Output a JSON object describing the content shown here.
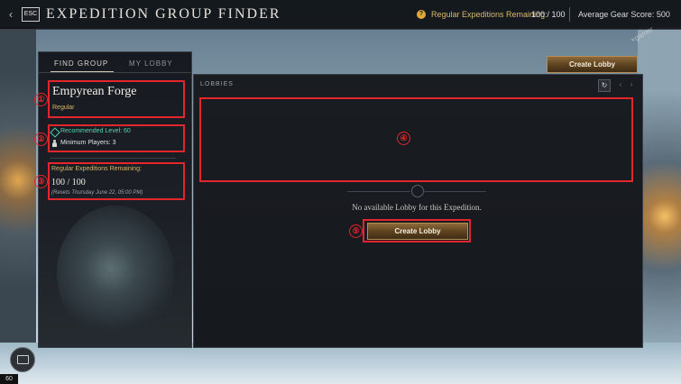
{
  "topbar": {
    "esc_label": "ESC",
    "back_icon": "chevron-left-icon",
    "title": "EXPEDITION GROUP FINDER",
    "regular_remaining_label": "Regular Expeditions Remaining:",
    "regular_remaining_count": "100 / 100",
    "gear_score": "Average Gear Score: 500"
  },
  "tabs": [
    {
      "label": "FIND GROUP",
      "active": true
    },
    {
      "label": "MY LOBBY",
      "active": false
    }
  ],
  "expedition": {
    "name": "Empyrean Forge",
    "type": "Regular",
    "recommended_level": "Recommended Level: 60",
    "min_players": "Minimum Players: 3",
    "remaining_label": "Regular Expeditions Remaining:",
    "remaining_count": "100 / 100",
    "reset_note": "(Resets Thursday June 22, 05:00 PM)"
  },
  "lobbies": {
    "section_label": "LOBBIES",
    "refresh_icon": "refresh-icon",
    "empty_message": "No available Lobby for this Expedition.",
    "create_button_label": "Create Lobby"
  },
  "header_create_button_label": "Create Lobby",
  "annotations": [
    "①",
    "②",
    "③",
    "④",
    "⑤"
  ],
  "fps": "60",
  "watermark": "×gamer",
  "colors": {
    "gold": "#d9b56a",
    "teal": "#58d5b8",
    "annotation_red": "#e2262b"
  }
}
